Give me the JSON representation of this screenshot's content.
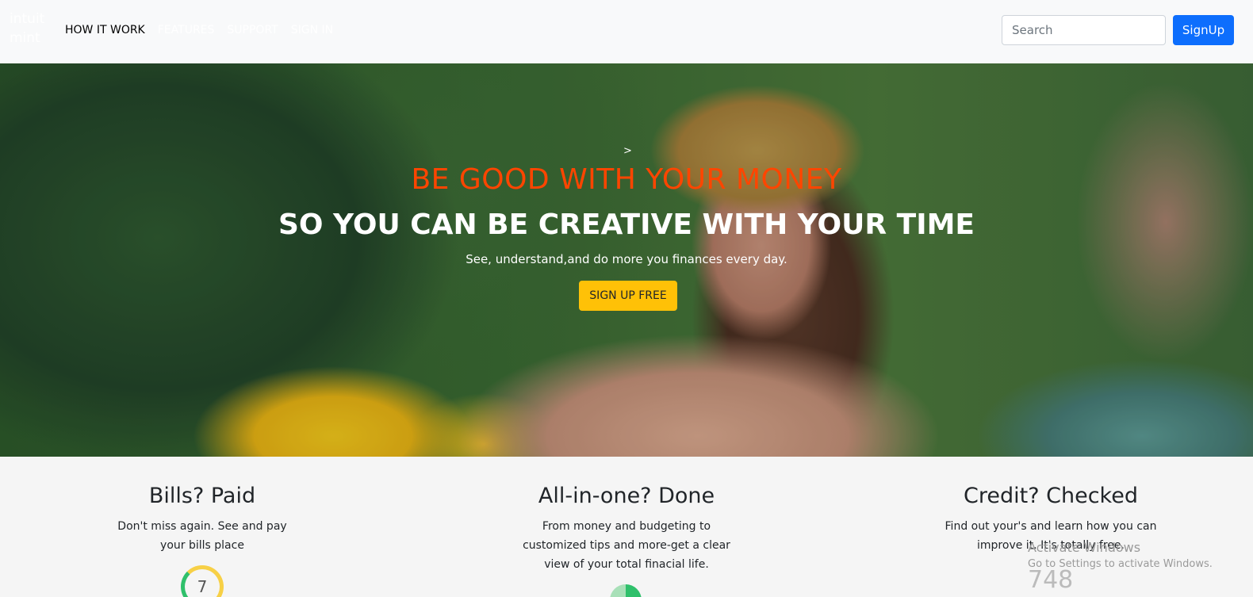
{
  "nav": {
    "brand_line1": "intuit",
    "brand_line2": "mint",
    "links": [
      "HOW IT WORK",
      "FEATURES",
      "SUPPORT",
      "SIGN IN"
    ],
    "search_placeholder": "Search",
    "signup_label": "SignUp"
  },
  "hero": {
    "caret": ">",
    "title_line1": "BE GOOD WITH YOUR MONEY",
    "title_line2": "SO YOU CAN BE CREATIVE WITH YOUR TIME",
    "subtitle": "See, understand,and do more you finances every day.",
    "cta_label": "SIGN UP FREE"
  },
  "features": [
    {
      "title": "Bills? Paid",
      "line1": "Don't miss again. See and pay",
      "line2": "your bills place",
      "line3": ""
    },
    {
      "title": "All-in-one? Done",
      "line1": "From money and budgeting to",
      "line2": "customized tips and more-get a clear",
      "line3": "view of your total finacial life."
    },
    {
      "title": "Credit? Checked",
      "line1": "Find out your's and learn how you can",
      "line2": "improve it. It's totally free.",
      "line3": ""
    }
  ],
  "widgets": {
    "gauge_value": "7",
    "credit_score": "748"
  },
  "watermark": {
    "title": "Activate Windows",
    "subtitle": "Go to Settings to activate Windows."
  }
}
